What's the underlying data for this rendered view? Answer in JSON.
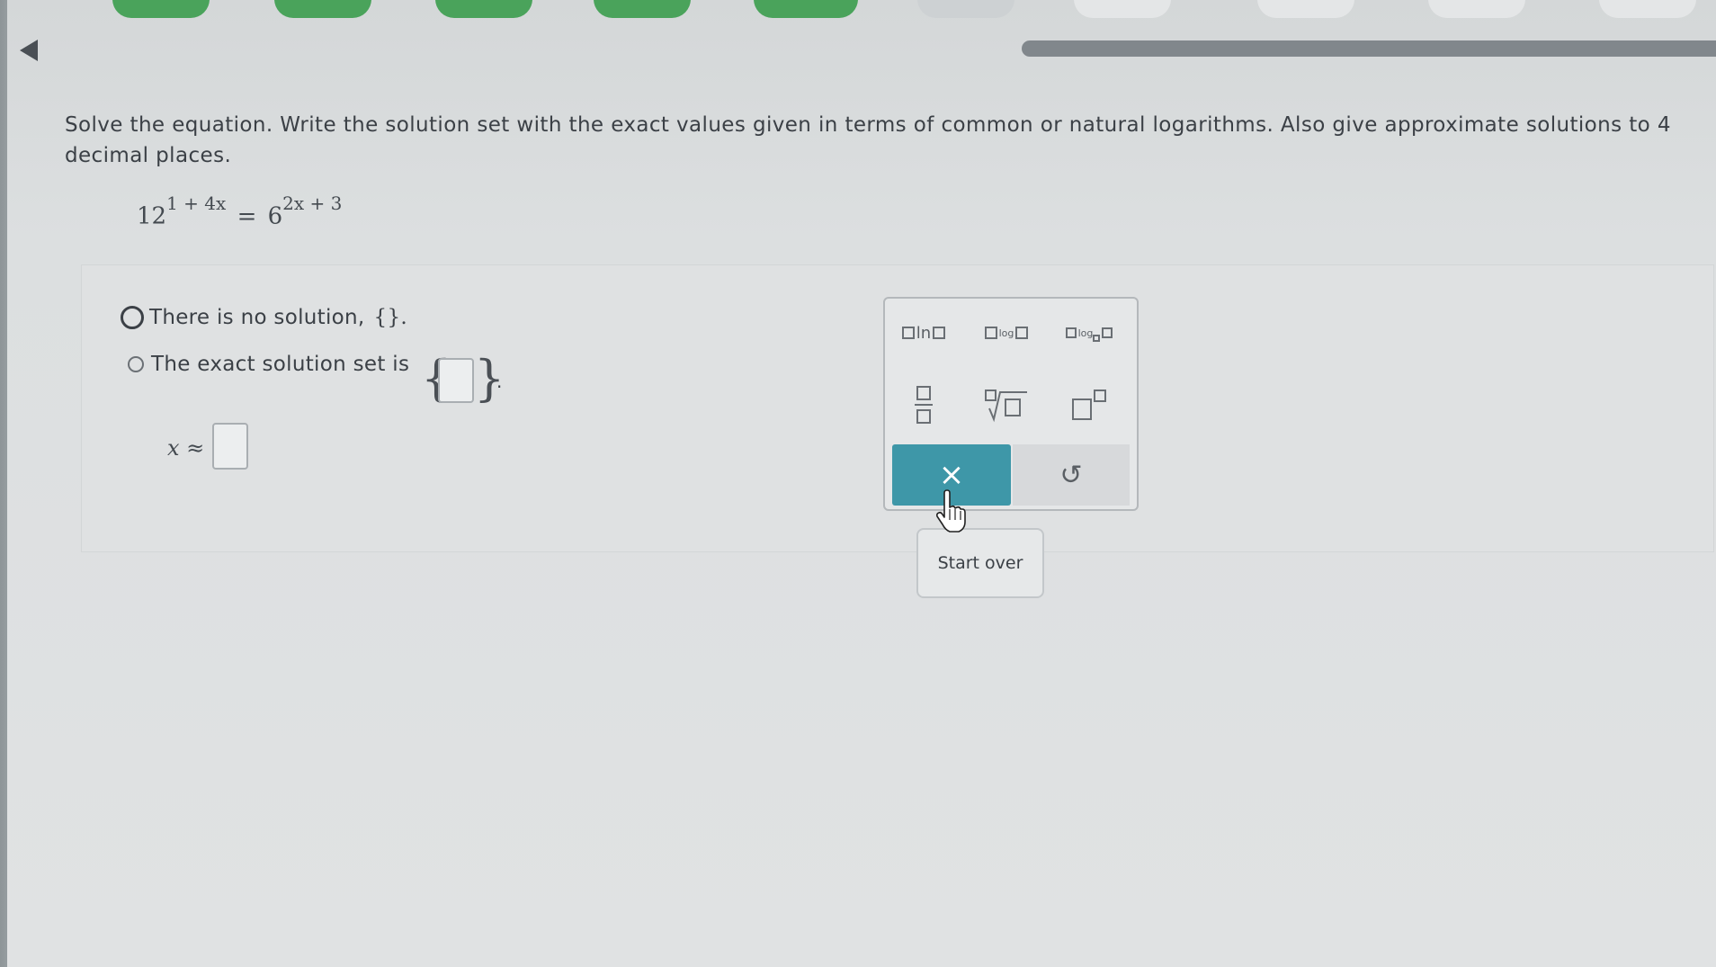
{
  "question": {
    "text": "Solve the equation. Write the solution set with the exact values given in terms of common or natural logarithms. Also give approximate solutions to 4 decimal places."
  },
  "equation": {
    "left_base": "12",
    "left_exp": "1 + 4x",
    "equals": "=",
    "right_base": "6",
    "right_exp": "2x + 3"
  },
  "options": {
    "no_solution_label": "There is no solution,",
    "no_solution_set": "{}.",
    "exact_label": "The exact solution set is",
    "exact_tail": "."
  },
  "approx": {
    "label": "x ≈",
    "value": ""
  },
  "palette": {
    "ln_label": "ln",
    "log_label": "log",
    "logb_label": "log",
    "clear_icon": "×",
    "undo_icon": "↺",
    "tooltip": "Start over"
  },
  "colors": {
    "accent": "#3e97a8",
    "nav_green": "#4aa35b"
  }
}
